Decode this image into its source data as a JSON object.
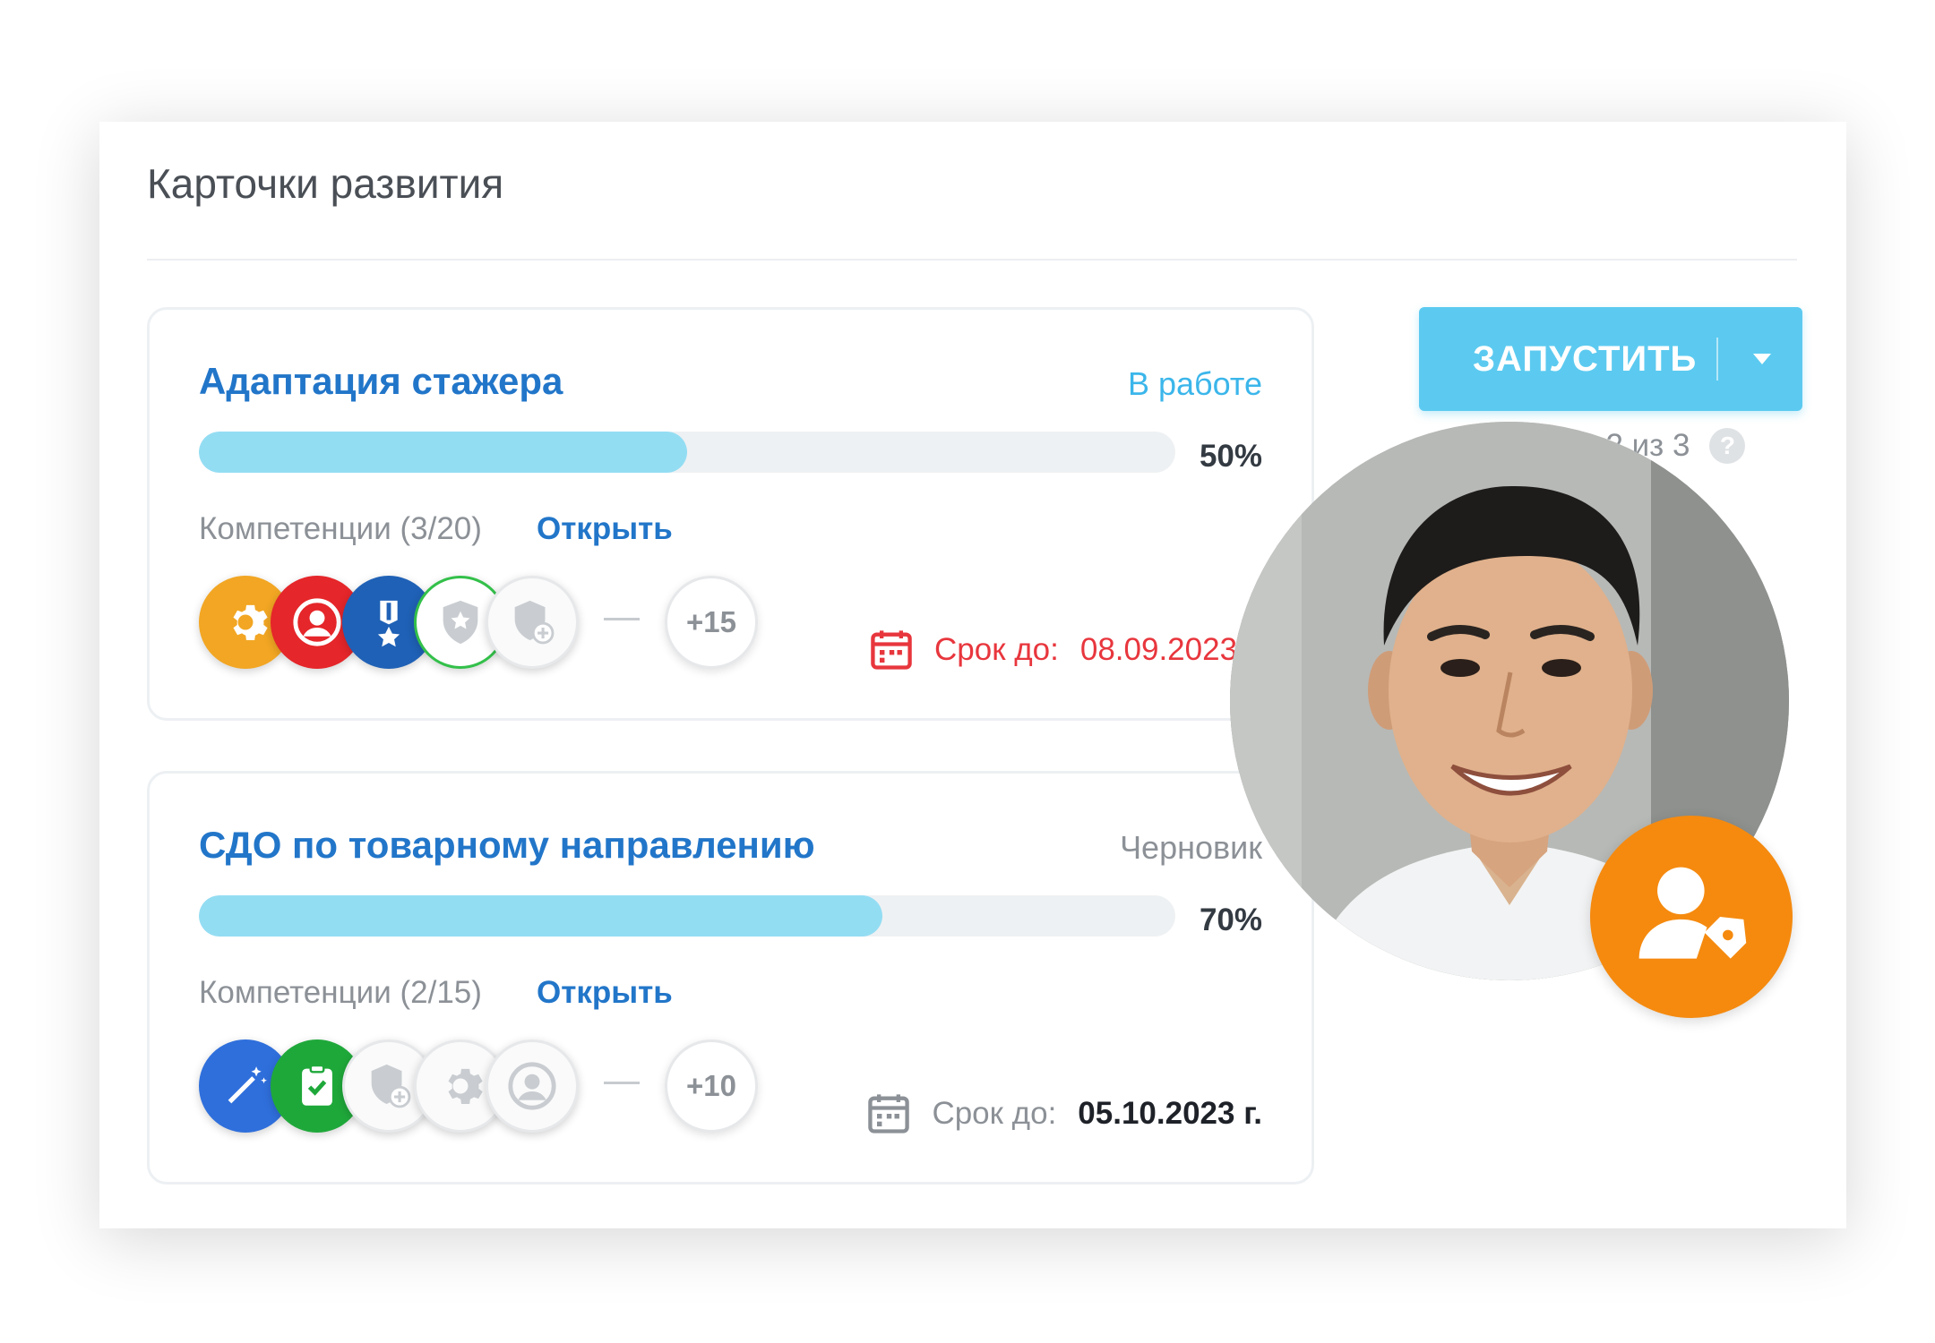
{
  "header": {
    "title": "Карточки развития"
  },
  "cards": [
    {
      "title": "Адаптация стажера",
      "status": "В работе",
      "status_color": "#3bb6ea",
      "progress": 50,
      "progress_label": "50%",
      "competencies_label": "Компетенции (3/20)",
      "open_label": "Открыть",
      "more_count": "+15",
      "deadline_label": "Срок до:",
      "deadline_value": "08.09.2023 г.",
      "deadline_color": "#e8363d",
      "badges": [
        {
          "icon": "gear-icon",
          "bg": "#f2a623"
        },
        {
          "icon": "user-icon",
          "bg": "#e5262a"
        },
        {
          "icon": "medal-icon",
          "bg": "#1f61b6"
        },
        {
          "icon": "star-shield-icon",
          "bg": "#ffffff"
        },
        {
          "icon": "shield-plus-icon",
          "bg": "#fafafa"
        }
      ]
    },
    {
      "title": "СДО по товарному направлению",
      "status": "Черновик",
      "status_color": "#8c9197",
      "progress": 70,
      "progress_label": "70%",
      "competencies_label": "Компетенции (2/15)",
      "open_label": "Открыть",
      "more_count": "+10",
      "deadline_label": "Срок до:",
      "deadline_value": "05.10.2023 г.",
      "deadline_color": "#1e2228",
      "badges": [
        {
          "icon": "magic-wand-icon",
          "bg": "#2f6fdc"
        },
        {
          "icon": "clipboard-check-icon",
          "bg": "#1fa83a"
        },
        {
          "icon": "shield-plus-icon",
          "bg": "#fafafa"
        },
        {
          "icon": "gear-icon",
          "bg": "#fafafa"
        },
        {
          "icon": "user-icon",
          "bg": "#fafafa"
        }
      ]
    }
  ],
  "launch": {
    "button_label": "ЗАПУСТИТЬ",
    "launched_text": "Запущено 2 из 3",
    "help": "?"
  },
  "colors": {
    "accent": "#5ccaf0",
    "link": "#2276c9",
    "progress_fill": "#93ddf3",
    "role_badge": "#f58a0f"
  }
}
